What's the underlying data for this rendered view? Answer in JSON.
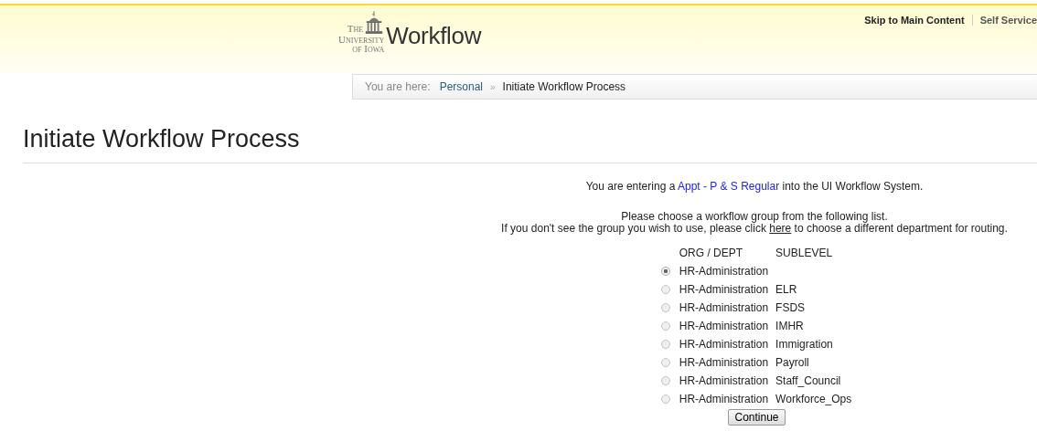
{
  "header": {
    "logo": {
      "university_lines": [
        "The",
        "University",
        "of Iowa"
      ],
      "wordmark": "Workflow"
    },
    "utility_links": [
      "Skip to Main Content",
      "Self Service"
    ]
  },
  "breadcrumb": {
    "label": "You are here:",
    "items": [
      {
        "text": "Personal",
        "kind": "link"
      },
      {
        "text": "Initiate Workflow Process",
        "kind": "current"
      }
    ],
    "separator": "»"
  },
  "page_title": "Initiate Workflow Process",
  "intro": {
    "before": "You are entering a ",
    "link": "Appt - P & S Regular",
    "after": " into the UI Workflow System."
  },
  "instructions": {
    "line_1": "Please choose a workflow group from the following list.",
    "line_2_before": "If you don't see the group you wish to use, please click ",
    "line_2_link": "here",
    "line_2_after": " to choose a different department for routing."
  },
  "table": {
    "columns": [
      "ORG / DEPT",
      "SUBLEVEL"
    ],
    "rows": [
      {
        "org": "HR-Administration",
        "sublevel": "",
        "selected": true
      },
      {
        "org": "HR-Administration",
        "sublevel": "ELR",
        "selected": false
      },
      {
        "org": "HR-Administration",
        "sublevel": "FSDS",
        "selected": false
      },
      {
        "org": "HR-Administration",
        "sublevel": "IMHR",
        "selected": false
      },
      {
        "org": "HR-Administration",
        "sublevel": "Immigration",
        "selected": false
      },
      {
        "org": "HR-Administration",
        "sublevel": "Payroll",
        "selected": false
      },
      {
        "org": "HR-Administration",
        "sublevel": "Staff_Council",
        "selected": false
      },
      {
        "org": "HR-Administration",
        "sublevel": "Workforce_Ops",
        "selected": false
      }
    ]
  },
  "continue_button": "Continue"
}
